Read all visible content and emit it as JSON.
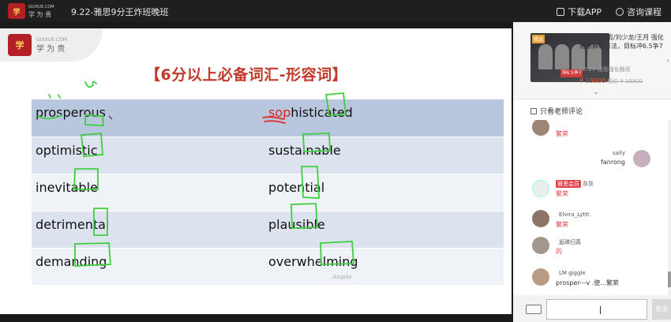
{
  "topbar": {
    "logo_text_top": "GUIXUE.COM",
    "logo_text": "学 为 贵",
    "course_title": "9.22-雅思9分王炸班晚班",
    "download_app": "下载APP",
    "consult": "咨询课程"
  },
  "slide": {
    "logo_url": "GUIXUE.COM",
    "logo_text": "学 为 贵",
    "heading": "【6分以上必备词汇-形容词】",
    "watermark": "Angela",
    "rows": [
      {
        "left": "prosperous",
        "right_red": "sop",
        "right_rest": "histicated"
      },
      {
        "left": "optimistic",
        "right_red": "",
        "right_rest": "sustainable"
      },
      {
        "left": "inevitable",
        "right_red": "",
        "right_rest": "potential"
      },
      {
        "left": "detrimental",
        "right_red": "",
        "right_rest": "plausible"
      },
      {
        "left": "demanding",
        "right_red": "",
        "right_rest": "overwhelming"
      }
    ]
  },
  "panel": {
    "promo": {
      "tag": "精品",
      "ribbon": "冲6.5争7",
      "title": "张强/田小雨/刘少龙/王月 强化雅思解题方法，目标冲6.5争7",
      "subtitle": "10.19-雅思强化晚班",
      "price": "¥ 13800",
      "old_price": "原价 ¥ 16800"
    },
    "filter_label": "只看老师评论",
    "messages": [
      {
        "name": "",
        "text": "繁荣",
        "red": true
      },
      {
        "name": "sally",
        "text": "fanrong",
        "red": false
      },
      {
        "name": "灰灰",
        "badge": "雅思会员",
        "text": "繁荣",
        "red": true
      },
      {
        "name": "Elvira_Lyttt",
        "text": "繁荣",
        "red": true
      },
      {
        "name": "逅瑛归真",
        "text": "的",
        "red": true
      },
      {
        "name": "LM giggle",
        "text": "prosper---v .使...繁荣",
        "red": false
      }
    ],
    "input_placeholder": "",
    "send_label": "发送"
  }
}
